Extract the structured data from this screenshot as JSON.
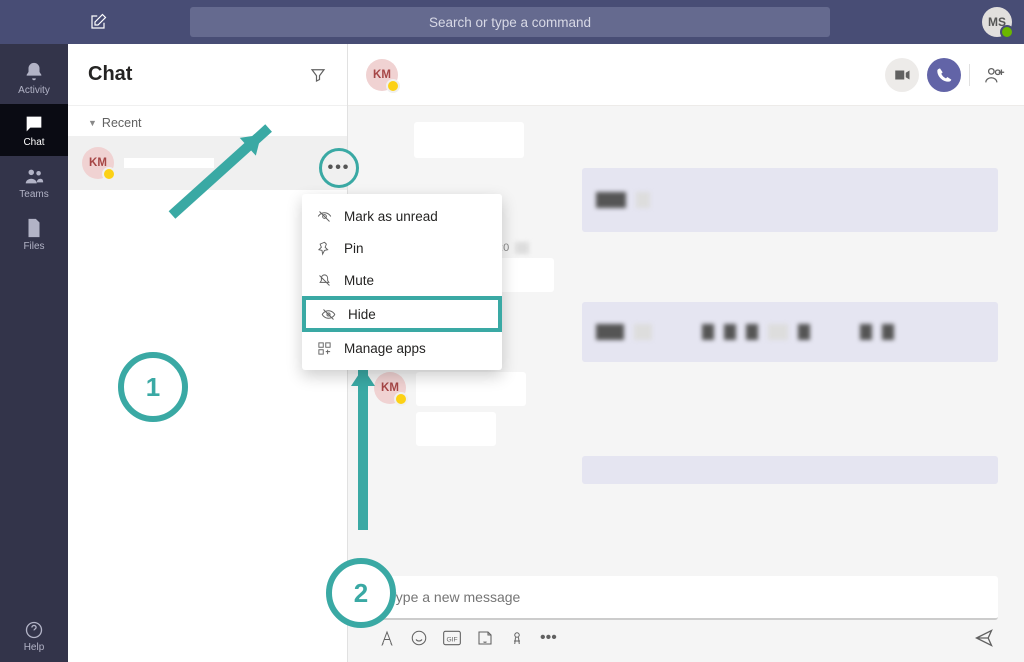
{
  "titlebar": {
    "search_placeholder": "Search or type a command",
    "profile_initials": "MS"
  },
  "rail": {
    "items": [
      {
        "label": "Activity",
        "icon": "bell-icon"
      },
      {
        "label": "Chat",
        "icon": "chat-icon"
      },
      {
        "label": "Teams",
        "icon": "teams-icon"
      },
      {
        "label": "Files",
        "icon": "file-icon"
      }
    ],
    "help_label": "Help"
  },
  "chatlist": {
    "title": "Chat",
    "section_recent": "Recent",
    "rows": [
      {
        "initials": "KM"
      }
    ]
  },
  "context_menu": {
    "items": [
      {
        "label": "Mark as unread"
      },
      {
        "label": "Pin"
      },
      {
        "label": "Mute"
      },
      {
        "label": "Hide"
      },
      {
        "label": "Manage apps"
      }
    ]
  },
  "chat_header": {
    "initials": "KM"
  },
  "messages": {
    "time1": "4:0"
  },
  "second_sender": {
    "initials": "KM"
  },
  "composer": {
    "placeholder": "Type a new message"
  },
  "annotations": {
    "step1": "1",
    "step2": "2"
  }
}
